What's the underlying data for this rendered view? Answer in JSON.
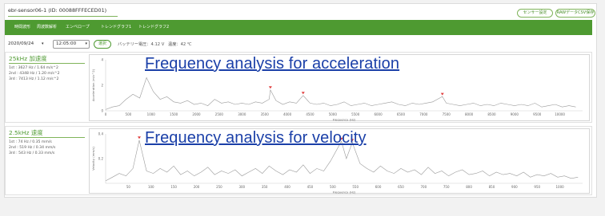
{
  "device": {
    "title": "ebr-sensor06-1 (ID: 00088FFFECED01)"
  },
  "header_buttons": {
    "sensor_settings": "センサー設定",
    "raw_save": "RAWデータCSV保存"
  },
  "tabs": [
    {
      "label": "時間波形"
    },
    {
      "label": "周波数解析"
    },
    {
      "label": "エンベロープ"
    },
    {
      "label": "トレンドグラフ1"
    },
    {
      "label": "トレンドグラフ2"
    }
  ],
  "controls": {
    "date": "2020/09/24",
    "date_caret": "▾",
    "time": "12:05:00",
    "select_label": "選択",
    "battery": "バッテリー電圧：4.12 V",
    "temperature": "温度：42 ℃"
  },
  "panels": {
    "acceleration": {
      "title": "25kHz 加速度",
      "peaks": [
        "1st : 3627 Hz / 1.64 m/s^2",
        "2nd : 4348 Hz / 1.20 m/s^2",
        "3rd : 7413 Hz / 1.12 m/s^2"
      ],
      "overlay": "Frequency analysis for acceleration"
    },
    "velocity": {
      "title": "2.5kHz 速度",
      "peaks": [
        "1st : 74 Hz / 0.35 mm/s",
        "2nd : 519 Hz / 0.34 mm/s",
        "3rd : 543 Hz / 0.33 mm/s"
      ],
      "overlay": "Frequency analysis for velocity"
    }
  },
  "chart_data": [
    {
      "type": "line",
      "title": "",
      "xlabel": "Frequency (Hz)",
      "ylabel": "Acceleration (m/s^2)",
      "xlim": [
        0,
        10500
      ],
      "ylim": [
        0,
        4
      ],
      "xticks": [
        0,
        500,
        1000,
        1500,
        2000,
        2500,
        3000,
        3500,
        4000,
        4500,
        5000,
        5500,
        6000,
        6500,
        7000,
        7500,
        8000,
        8500,
        9000,
        9500,
        10000
      ],
      "yticks": [
        0,
        2,
        4
      ],
      "line_color": "#9a9a9a",
      "marker_color": "#e03c3c",
      "peaks": [
        {
          "x": 3627,
          "y": 1.64
        },
        {
          "x": 4348,
          "y": 1.2
        },
        {
          "x": 7413,
          "y": 1.12
        }
      ],
      "series": [
        {
          "x": [
            0,
            150,
            300,
            450,
            600,
            750,
            900,
            1050,
            1200,
            1350,
            1500,
            1650,
            1800,
            1950,
            2100,
            2250,
            2400,
            2550,
            2700,
            2850,
            3000,
            3150,
            3300,
            3450,
            3600,
            3627,
            3750,
            3900,
            4050,
            4200,
            4348,
            4500,
            4650,
            4800,
            4950,
            5100,
            5250,
            5400,
            5550,
            5700,
            5850,
            6000,
            6150,
            6300,
            6450,
            6600,
            6750,
            6900,
            7050,
            7200,
            7413,
            7500,
            7650,
            7800,
            7950,
            8100,
            8250,
            8400,
            8550,
            8700,
            8850,
            9000,
            9150,
            9300,
            9450,
            9600,
            9750,
            9900,
            10050,
            10200,
            10350
          ],
          "y": [
            0.1,
            0.3,
            0.4,
            0.9,
            1.3,
            1.0,
            2.6,
            1.5,
            0.9,
            1.1,
            0.7,
            0.6,
            0.8,
            0.5,
            0.6,
            0.4,
            0.9,
            0.6,
            0.7,
            0.5,
            0.6,
            0.5,
            0.7,
            0.6,
            0.9,
            1.64,
            0.8,
            0.5,
            0.7,
            0.6,
            1.2,
            0.6,
            0.5,
            0.6,
            0.4,
            0.5,
            0.7,
            0.4,
            0.5,
            0.6,
            0.4,
            0.5,
            0.6,
            0.7,
            0.5,
            0.4,
            0.6,
            0.5,
            0.6,
            0.7,
            1.12,
            0.6,
            0.5,
            0.4,
            0.5,
            0.6,
            0.4,
            0.5,
            0.4,
            0.6,
            0.5,
            0.4,
            0.5,
            0.4,
            0.6,
            0.3,
            0.4,
            0.5,
            0.3,
            0.4,
            0.3
          ]
        }
      ]
    },
    {
      "type": "line",
      "title": "",
      "xlabel": "Frequency (Hz)",
      "ylabel": "Velocity (mm/s)",
      "xlim": [
        0,
        1050
      ],
      "ylim": [
        0,
        0.4
      ],
      "xticks": [
        50,
        100,
        150,
        200,
        250,
        300,
        350,
        400,
        450,
        500,
        550,
        600,
        650,
        700,
        750,
        800,
        850,
        900,
        950,
        1000
      ],
      "yticks": [
        0.2,
        0.4
      ],
      "line_color": "#9a9a9a",
      "marker_color": "#e03c3c",
      "peaks": [
        {
          "x": 74,
          "y": 0.35
        },
        {
          "x": 519,
          "y": 0.34
        },
        {
          "x": 543,
          "y": 0.33
        }
      ],
      "series": [
        {
          "x": [
            0,
            15,
            30,
            45,
            60,
            74,
            90,
            105,
            120,
            135,
            150,
            165,
            180,
            195,
            210,
            225,
            240,
            255,
            270,
            285,
            300,
            315,
            330,
            345,
            360,
            375,
            390,
            405,
            420,
            435,
            450,
            465,
            480,
            495,
            519,
            530,
            543,
            560,
            575,
            590,
            605,
            620,
            635,
            650,
            665,
            680,
            695,
            710,
            725,
            740,
            755,
            770,
            785,
            800,
            815,
            830,
            845,
            860,
            875,
            890,
            905,
            920,
            935,
            950,
            965,
            980,
            995,
            1010,
            1025,
            1040
          ],
          "y": [
            0.02,
            0.05,
            0.08,
            0.06,
            0.12,
            0.35,
            0.1,
            0.08,
            0.12,
            0.09,
            0.14,
            0.07,
            0.1,
            0.06,
            0.09,
            0.13,
            0.07,
            0.1,
            0.08,
            0.11,
            0.06,
            0.09,
            0.12,
            0.08,
            0.14,
            0.1,
            0.07,
            0.11,
            0.09,
            0.15,
            0.08,
            0.12,
            0.1,
            0.18,
            0.34,
            0.2,
            0.33,
            0.16,
            0.12,
            0.09,
            0.14,
            0.1,
            0.08,
            0.12,
            0.09,
            0.11,
            0.07,
            0.13,
            0.08,
            0.1,
            0.06,
            0.09,
            0.11,
            0.07,
            0.08,
            0.1,
            0.06,
            0.09,
            0.07,
            0.08,
            0.06,
            0.09,
            0.05,
            0.07,
            0.06,
            0.08,
            0.05,
            0.06,
            0.04,
            0.05
          ]
        }
      ]
    }
  ]
}
